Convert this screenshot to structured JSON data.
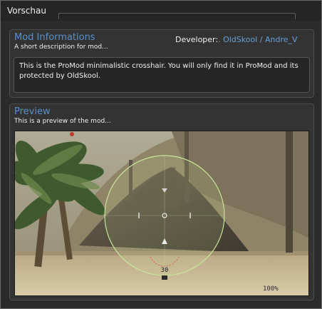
{
  "tab": {
    "label": "Vorschau"
  },
  "info": {
    "title": "Mod Informations",
    "subtitle": "A short description for mod...",
    "developer_label": "Developer:",
    "developer_value": ". OldSkool / Andre_V",
    "description": "This is the ProMod minimalistic crosshair. You will only find it in ProMod and its protected by OldSkool."
  },
  "preview": {
    "title": "Preview",
    "subtitle": "This is a preview of the mod...",
    "rangefinder": "30",
    "zoom": "100%"
  },
  "colors": {
    "accent": "#5b8fc7",
    "developer": "#6a9fd4",
    "crosshair": "#c8e39a"
  }
}
